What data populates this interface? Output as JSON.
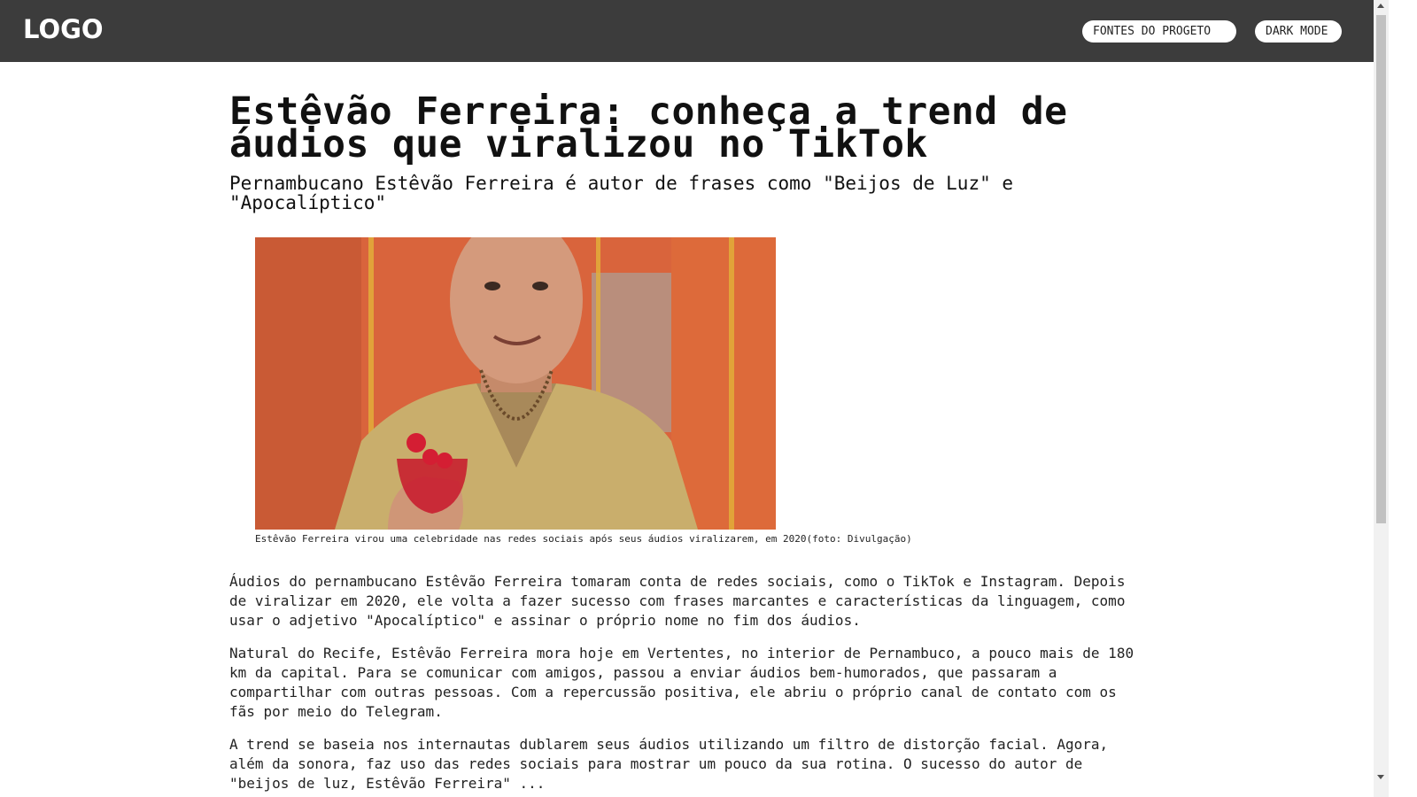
{
  "header": {
    "logo": "LOGO",
    "sources_button": "FONTES DO PROGETO",
    "dark_mode_button": "DARK MODE"
  },
  "article": {
    "title": "Estêvão Ferreira: conheça a trend de áudios que viralizou no TikTok",
    "subtitle": "Pernambucano Estêvão Ferreira é autor de frases como \"Beijos de Luz\" e \"Apocalíptico\"",
    "image_caption": "Estêvão Ferreira virou uma celebridade nas redes sociais após seus áudios viralizarem, em 2020(foto: Divulgação)",
    "paragraphs": [
      "Áudios do pernambucano Estêvão Ferreira tomaram conta de redes sociais, como o TikTok e Instagram. Depois de viralizar em 2020, ele volta a fazer sucesso com frases marcantes e características da linguagem, como usar o adjetivo \"Apocalíptico\" e assinar o próprio nome no fim dos áudios.",
      "Natural do Recife, Estêvão Ferreira mora hoje em Vertentes, no interior de Pernambuco, a pouco mais de 180 km da capital. Para se comunicar com amigos, passou a enviar áudios bem-humorados, que passaram a compartilhar com outras pessoas. Com a repercussão positiva, ele abriu o próprio canal de contato com os fãs por meio do Telegram.",
      "A trend se baseia nos internautas dublarem seus áudios utilizando um filtro de distorção facial. Agora, além da sonora, faz uso das redes sociais para mostrar um pouco da sua rotina. O sucesso do autor de \"beijos de luz, Estêvão Ferreira\" ..."
    ]
  }
}
